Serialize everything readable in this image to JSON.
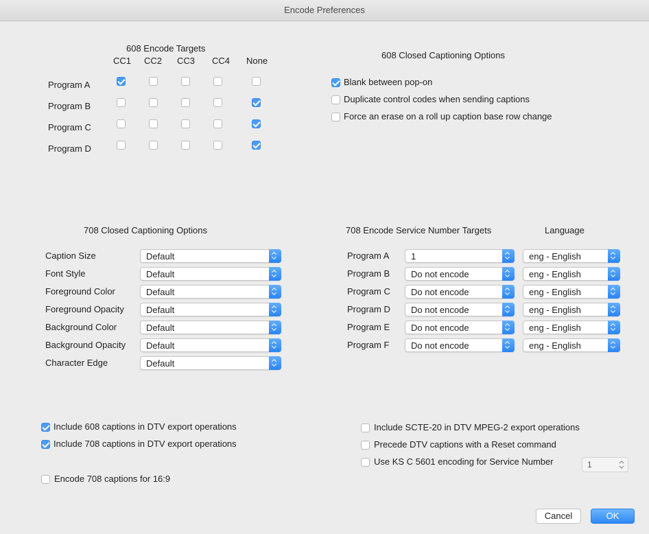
{
  "window": {
    "title": "Encode Preferences"
  },
  "targets608": {
    "title": "608 Encode Targets",
    "columns": [
      "CC1",
      "CC2",
      "CC3",
      "CC4",
      "None"
    ],
    "rows": [
      {
        "label": "Program A",
        "checked": [
          true,
          false,
          false,
          false,
          false
        ]
      },
      {
        "label": "Program B",
        "checked": [
          false,
          false,
          false,
          false,
          true
        ]
      },
      {
        "label": "Program C",
        "checked": [
          false,
          false,
          false,
          false,
          true
        ]
      },
      {
        "label": "Program D",
        "checked": [
          false,
          false,
          false,
          false,
          true
        ]
      }
    ]
  },
  "options608": {
    "title": "608 Closed Captioning Options",
    "items": [
      {
        "label": "Blank between pop-on",
        "checked": true
      },
      {
        "label": "Duplicate control codes when sending captions",
        "checked": false
      },
      {
        "label": "Force an erase on a roll up caption base row change",
        "checked": false
      }
    ]
  },
  "options708": {
    "title": "708 Closed Captioning Options",
    "rows": [
      {
        "label": "Caption Size",
        "value": "Default"
      },
      {
        "label": "Font Style",
        "value": "Default"
      },
      {
        "label": "Foreground Color",
        "value": "Default"
      },
      {
        "label": "Foreground Opacity",
        "value": "Default"
      },
      {
        "label": "Background Color",
        "value": "Default"
      },
      {
        "label": "Background Opacity",
        "value": "Default"
      },
      {
        "label": "Character Edge",
        "value": "Default"
      }
    ]
  },
  "targets708": {
    "title": "708 Encode Service Number Targets",
    "language_header": "Language",
    "rows": [
      {
        "label": "Program A",
        "service": "1",
        "language": "eng - English"
      },
      {
        "label": "Program B",
        "service": "Do not encode",
        "language": "eng - English"
      },
      {
        "label": "Program C",
        "service": "Do not encode",
        "language": "eng - English"
      },
      {
        "label": "Program D",
        "service": "Do not encode",
        "language": "eng - English"
      },
      {
        "label": "Program E",
        "service": "Do not encode",
        "language": "eng - English"
      },
      {
        "label": "Program F",
        "service": "Do not encode",
        "language": "eng - English"
      }
    ]
  },
  "export_left": [
    {
      "label": "Include 608 captions in DTV export operations",
      "checked": true
    },
    {
      "label": "Include 708 captions in DTV export operations",
      "checked": true
    }
  ],
  "export_right": [
    {
      "label": "Include SCTE-20 in DTV MPEG-2 export operations",
      "checked": false
    },
    {
      "label": "Precede DTV captions with a Reset command",
      "checked": false
    },
    {
      "label": "Use KS C 5601 encoding for Service Number",
      "checked": false
    }
  ],
  "ks_stepper": {
    "value": "1"
  },
  "encode169": {
    "label": "Encode 708 captions for 16:9",
    "checked": false
  },
  "buttons": {
    "cancel": "Cancel",
    "ok": "OK"
  },
  "colors": {
    "accent": "#4a9cf5",
    "window_bg": "#ececec"
  },
  "icons": {
    "select_arrow": "up-down-chevron-icon",
    "check": "checkmark-icon"
  }
}
